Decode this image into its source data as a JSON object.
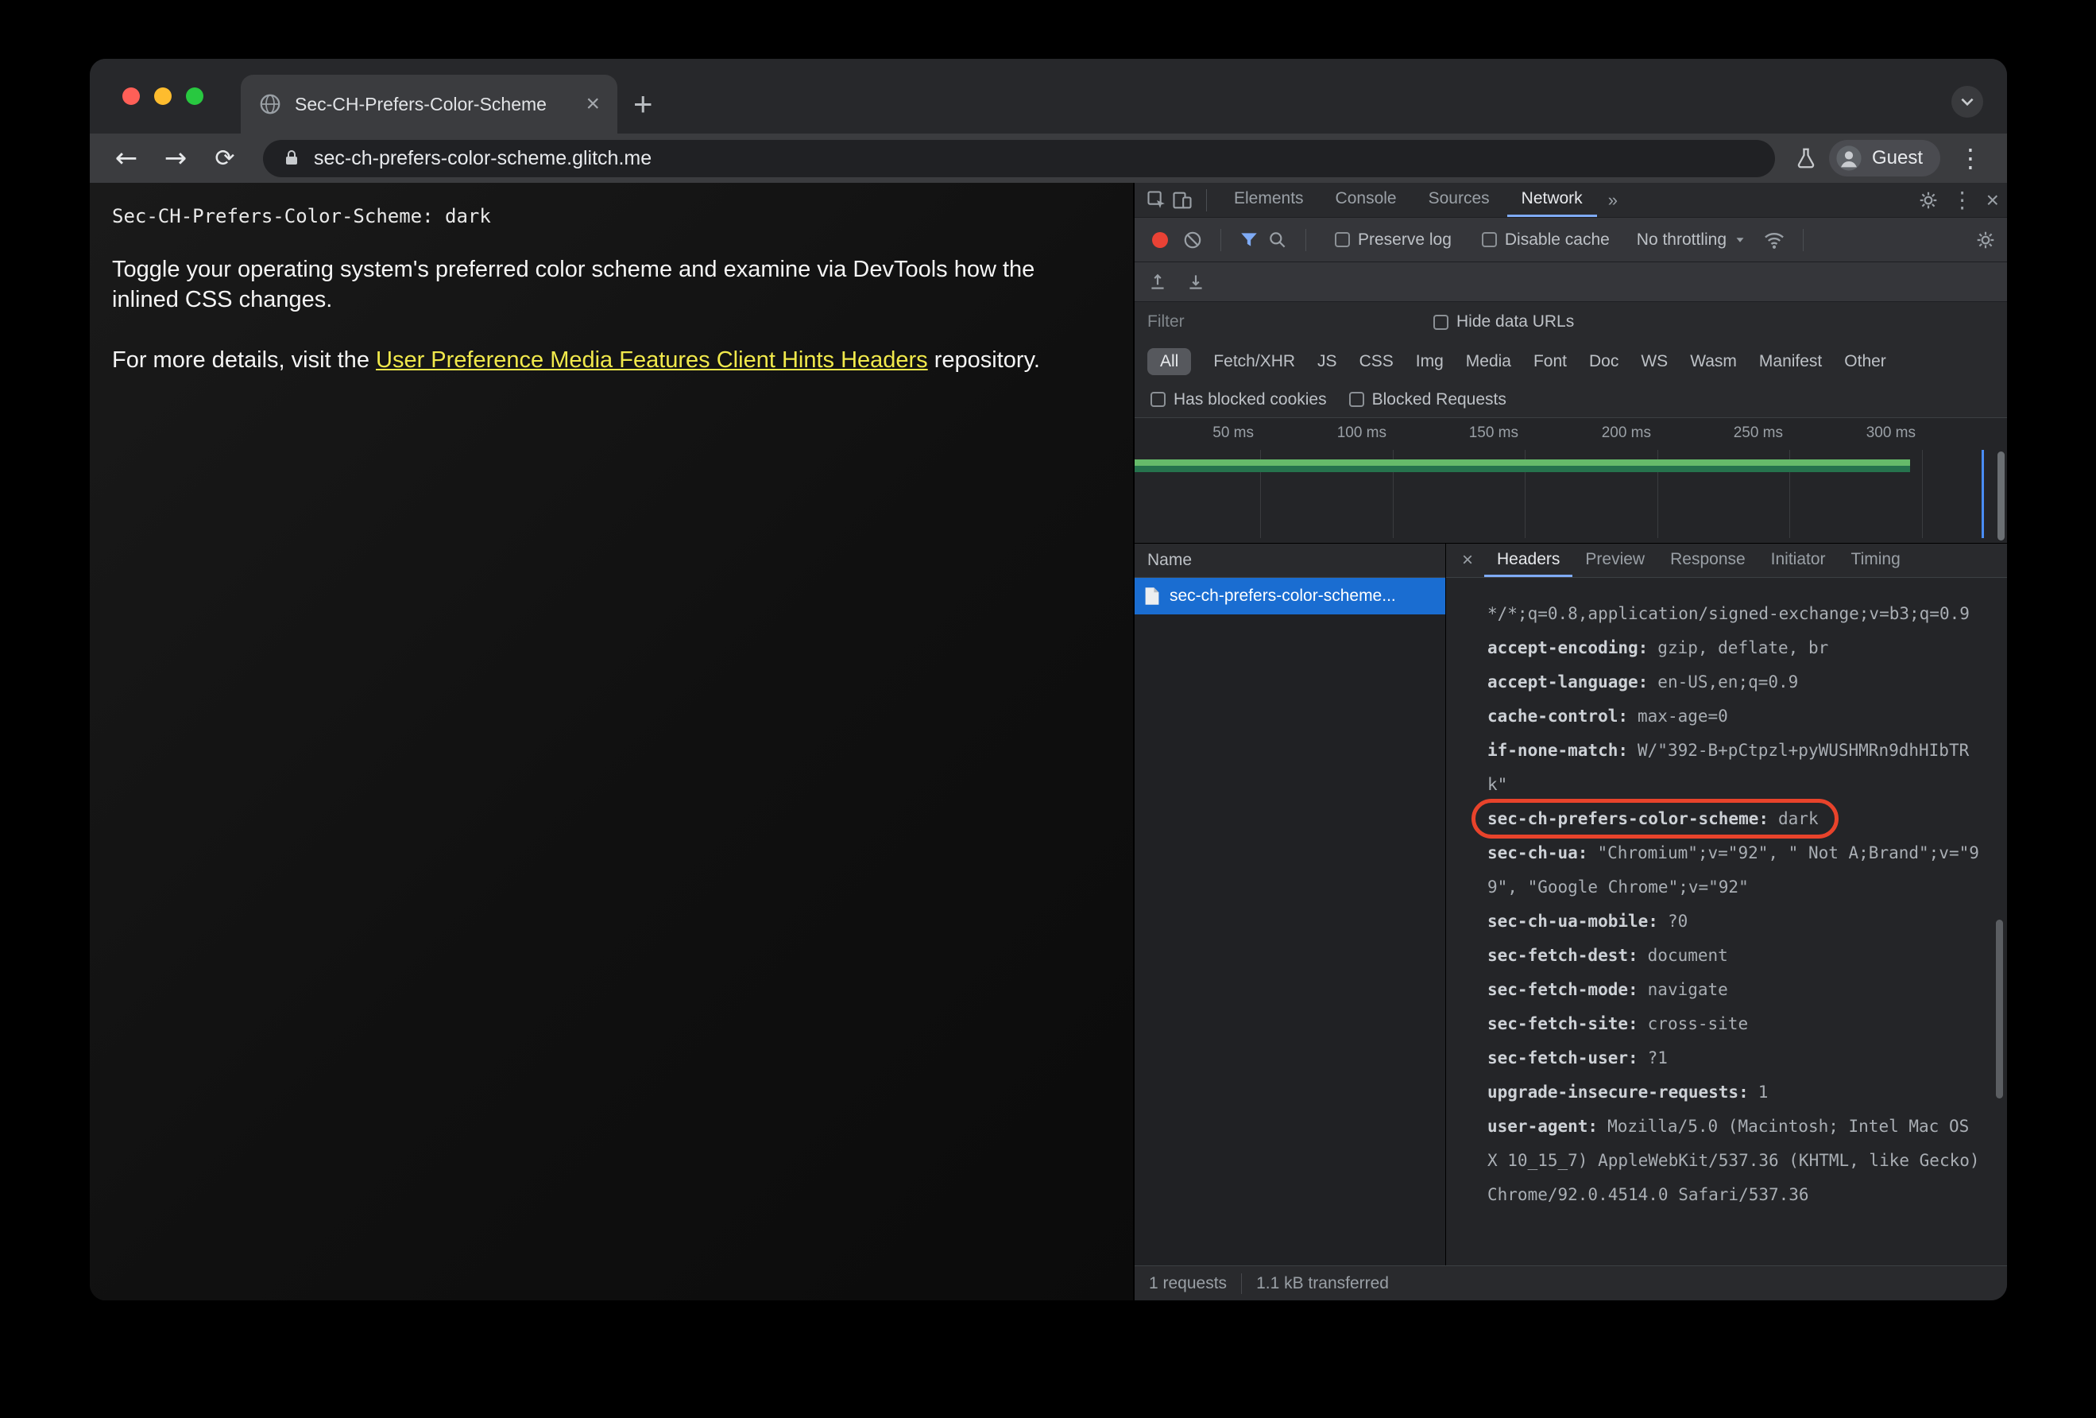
{
  "colors": {
    "accent_blue": "#7fabf5",
    "selection_blue": "#1a6dd1",
    "record_red": "#e94235",
    "link_yellow": "#f1e94b",
    "annotation_red": "#e8432b",
    "overview_green": "#66bb6a",
    "overview_green_dark": "#26734d",
    "event_blue": "#4a8df8",
    "traffic_red": "#ff5f57",
    "traffic_yellow": "#febc2e",
    "traffic_green": "#28c840"
  },
  "browser": {
    "tab_title": "Sec-CH-Prefers-Color-Scheme",
    "new_tab_glyph": "+",
    "tab_close_glyph": "×",
    "back_glyph": "←",
    "forward_glyph": "→",
    "reload_glyph": "⟳",
    "url": "sec-ch-prefers-color-scheme.glitch.me",
    "profile_label": "Guest",
    "menu_glyph": "⋮"
  },
  "page": {
    "code_line": "Sec-CH-Prefers-Color-Scheme: dark",
    "paragraph1": "Toggle your operating system's preferred color scheme and examine via DevTools how the inlined CSS changes.",
    "paragraph2_prefix": "For more details, visit the ",
    "paragraph2_link": "User Preference Media Features Client Hints Headers",
    "paragraph2_suffix": " repository."
  },
  "devtools": {
    "panel_tabs": [
      "Elements",
      "Console",
      "Sources",
      "Network"
    ],
    "more_tabs_glyph": "»",
    "close_glyph": "×",
    "menu_glyph": "⋮",
    "network": {
      "preserve_log": "Preserve log",
      "disable_cache": "Disable cache",
      "throttling": "No throttling",
      "filter_placeholder": "Filter",
      "hide_data_urls": "Hide data URLs",
      "pills": [
        "All",
        "Fetch/XHR",
        "JS",
        "CSS",
        "Img",
        "Media",
        "Font",
        "Doc",
        "WS",
        "Wasm",
        "Manifest",
        "Other"
      ],
      "has_blocked_cookies": "Has blocked cookies",
      "blocked_requests": "Blocked Requests",
      "ruler_ticks": [
        "50 ms",
        "100 ms",
        "150 ms",
        "200 ms",
        "250 ms",
        "300 ms"
      ],
      "name_header": "Name",
      "request_name": "sec-ch-prefers-color-scheme...",
      "detail_tabs": [
        "Headers",
        "Preview",
        "Response",
        "Initiator",
        "Timing"
      ],
      "status_requests": "1 requests",
      "status_transferred": "1.1 kB transferred"
    },
    "request_headers": [
      {
        "key": "",
        "value": "*/*;q=0.8,application/signed-exchange;v=b3;q=0.9"
      },
      {
        "key": "accept-encoding:",
        "value": "gzip, deflate, br"
      },
      {
        "key": "accept-language:",
        "value": "en-US,en;q=0.9"
      },
      {
        "key": "cache-control:",
        "value": "max-age=0"
      },
      {
        "key": "if-none-match:",
        "value": "W/\"392-B+pCtpzl+pyWUSHMRn9dhHIbTRk\""
      },
      {
        "key": "sec-ch-prefers-color-scheme:",
        "value": "dark"
      },
      {
        "key": "sec-ch-ua:",
        "value": "\"Chromium\";v=\"92\", \" Not A;Brand\";v=\"99\", \"Google Chrome\";v=\"92\""
      },
      {
        "key": "sec-ch-ua-mobile:",
        "value": "?0"
      },
      {
        "key": "sec-fetch-dest:",
        "value": "document"
      },
      {
        "key": "sec-fetch-mode:",
        "value": "navigate"
      },
      {
        "key": "sec-fetch-site:",
        "value": "cross-site"
      },
      {
        "key": "sec-fetch-user:",
        "value": "?1"
      },
      {
        "key": "upgrade-insecure-requests:",
        "value": "1"
      },
      {
        "key": "user-agent:",
        "value": "Mozilla/5.0 (Macintosh; Intel Mac OS X 10_15_7) AppleWebKit/537.36 (KHTML, like Gecko) Chrome/92.0.4514.0 Safari/537.36"
      }
    ]
  }
}
